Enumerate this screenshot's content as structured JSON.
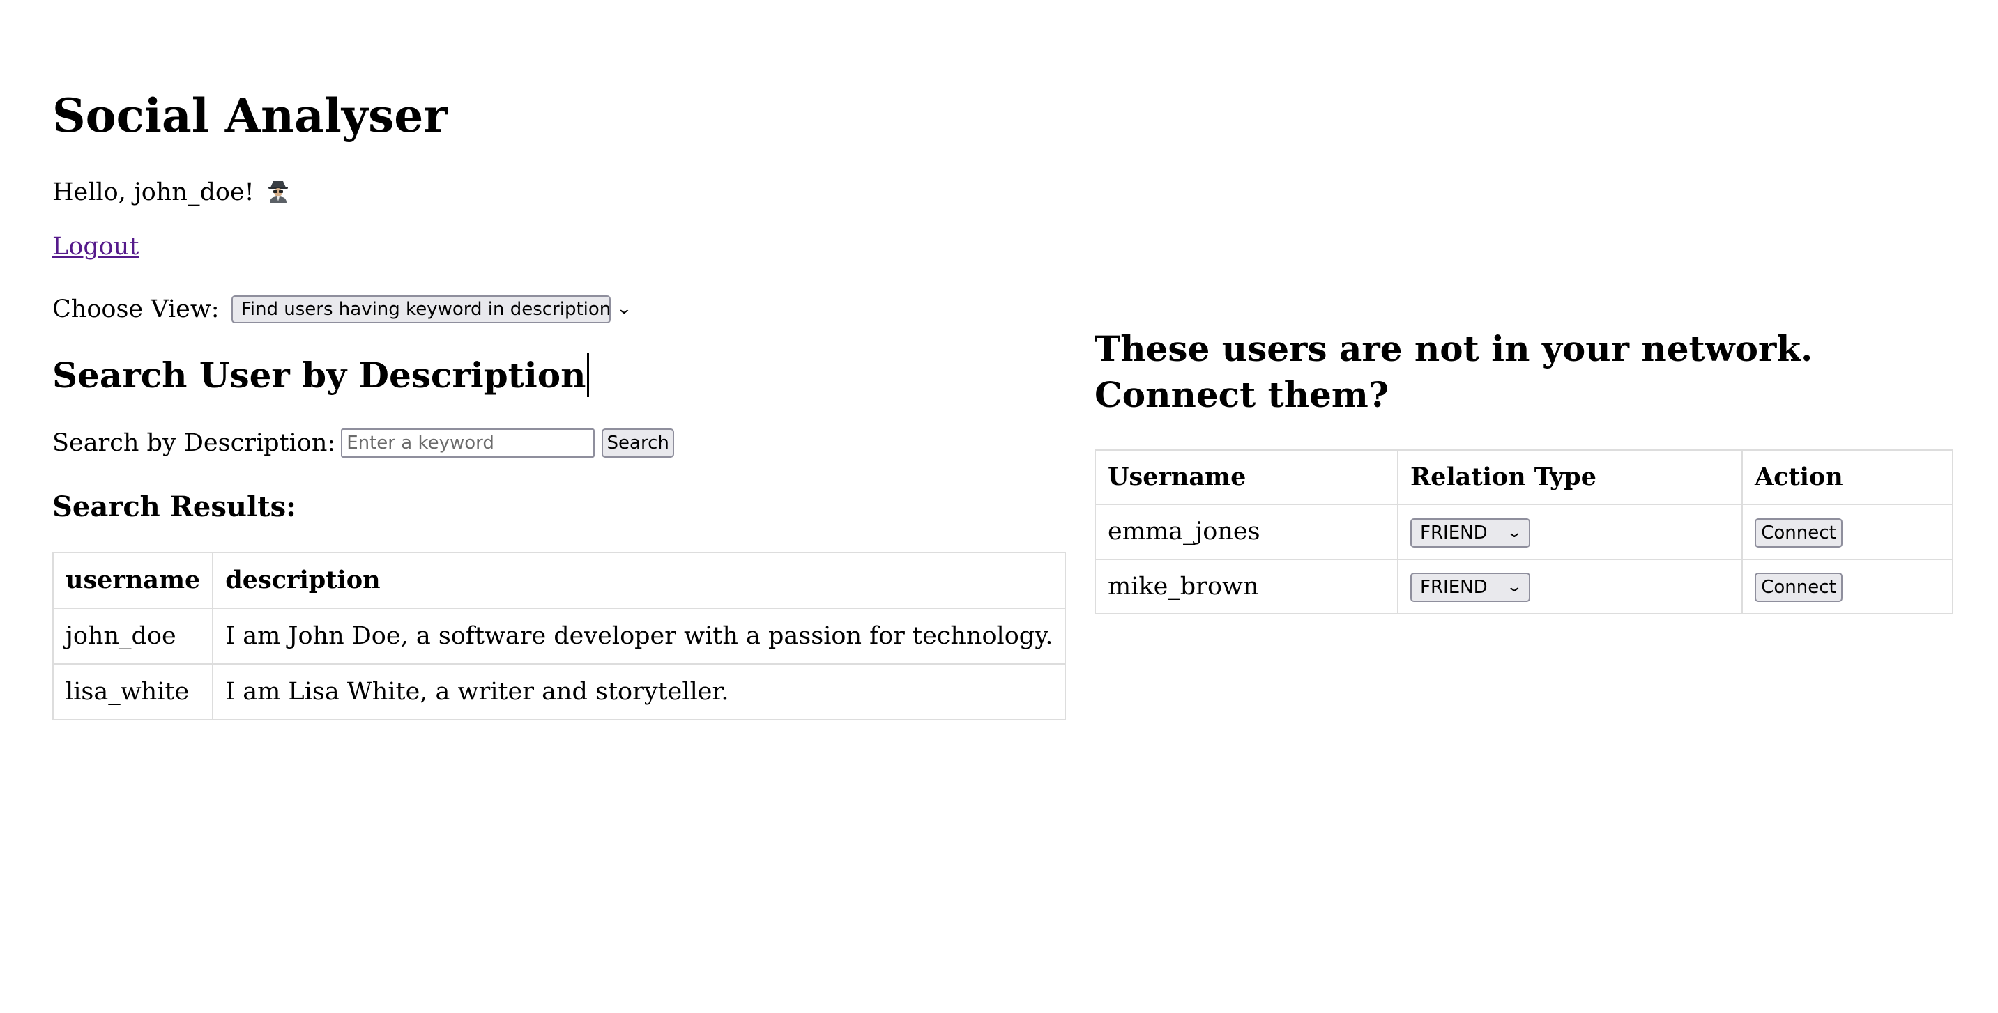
{
  "app": {
    "title": "Social Analyser"
  },
  "greeting": {
    "text": "Hello, john_doe!",
    "icon": "spy-icon"
  },
  "logout": {
    "label": "Logout"
  },
  "view": {
    "label": "Choose View:",
    "selected": "Find users having keyword in description"
  },
  "search": {
    "title": "Search User by Description",
    "label": "Search by Description:",
    "placeholder": "Enter a keyword",
    "value": "",
    "button_label": "Search"
  },
  "results": {
    "title": "Search Results:",
    "columns": [
      "username",
      "description"
    ],
    "rows": [
      {
        "username": "john_doe",
        "description": "I am John Doe, a software developer with a passion for technology."
      },
      {
        "username": "lisa_white",
        "description": "I am Lisa White, a writer and storyteller."
      }
    ]
  },
  "network": {
    "title": "These users are not in your network. Connect them?",
    "columns": [
      "Username",
      "Relation Type",
      "Action"
    ],
    "rows": [
      {
        "username": "emma_jones",
        "relation": "FRIEND",
        "action": "Connect"
      },
      {
        "username": "mike_brown",
        "relation": "FRIEND",
        "action": "Connect"
      }
    ]
  },
  "colors": {
    "link_visited": "#551a8b",
    "control_bg": "#e9e9ed",
    "control_border": "#8f8f9d",
    "table_border": "#dddddd"
  }
}
